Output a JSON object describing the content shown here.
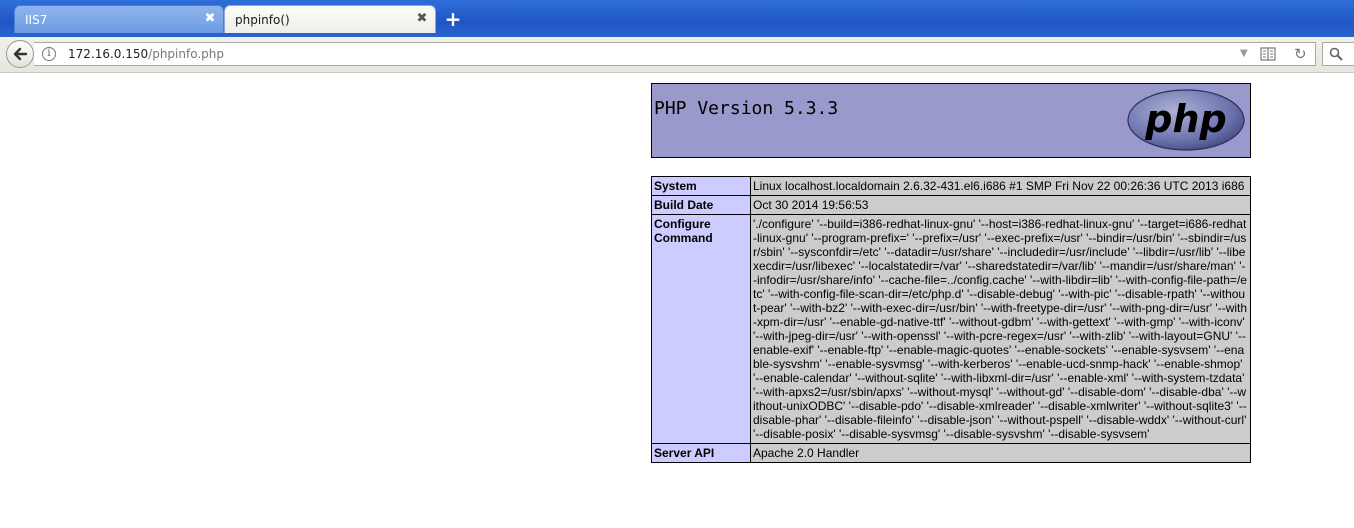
{
  "browser": {
    "tabs": [
      {
        "label": "IIS7",
        "active": false
      },
      {
        "label": "phpinfo()",
        "active": true
      }
    ],
    "new_tab_label": "+",
    "close_glyph": "✖",
    "url_host": "172.16.0.150",
    "url_path": "/phpinfo.php",
    "info_glyph": "i",
    "reload_glyph": "↻",
    "dropdown_glyph": "▼",
    "icons": [
      "back-arrow-icon",
      "info-icon",
      "reader-view-icon",
      "reload-icon",
      "search-icon",
      "close-icon",
      "new-tab-icon"
    ]
  },
  "php": {
    "version_title": "PHP Version 5.3.3",
    "logo_text": "php",
    "colors": {
      "header_bg": "#9999cc",
      "key_bg": "#ccccff",
      "value_bg": "#cccccc"
    },
    "rows": [
      {
        "key": "System",
        "value": "Linux localhost.localdomain 2.6.32-431.el6.i686 #1 SMP Fri Nov 22 00:26:36 UTC 2013 i686"
      },
      {
        "key": "Build Date",
        "value": "Oct 30 2014 19:56:53"
      },
      {
        "key": "Configure Command",
        "value": "'./configure' '--build=i386-redhat-linux-gnu' '--host=i386-redhat-linux-gnu' '--target=i686-redhat-linux-gnu' '--program-prefix=' '--prefix=/usr' '--exec-prefix=/usr' '--bindir=/usr/bin' '--sbindir=/usr/sbin' '--sysconfdir=/etc' '--datadir=/usr/share' '--includedir=/usr/include' '--libdir=/usr/lib' '--libexecdir=/usr/libexec' '--localstatedir=/var' '--sharedstatedir=/var/lib' '--mandir=/usr/share/man' '--infodir=/usr/share/info' '--cache-file=../config.cache' '--with-libdir=lib' '--with-config-file-path=/etc' '--with-config-file-scan-dir=/etc/php.d' '--disable-debug' '--with-pic' '--disable-rpath' '--without-pear' '--with-bz2' '--with-exec-dir=/usr/bin' '--with-freetype-dir=/usr' '--with-png-dir=/usr' '--with-xpm-dir=/usr' '--enable-gd-native-ttf' '--without-gdbm' '--with-gettext' '--with-gmp' '--with-iconv' '--with-jpeg-dir=/usr' '--with-openssl' '--with-pcre-regex=/usr' '--with-zlib' '--with-layout=GNU' '--enable-exif' '--enable-ftp' '--enable-magic-quotes' '--enable-sockets' '--enable-sysvsem' '--enable-sysvshm' '--enable-sysvmsg' '--with-kerberos' '--enable-ucd-snmp-hack' '--enable-shmop' '--enable-calendar' '--without-sqlite' '--with-libxml-dir=/usr' '--enable-xml' '--with-system-tzdata' '--with-apxs2=/usr/sbin/apxs' '--without-mysql' '--without-gd' '--disable-dom' '--disable-dba' '--without-unixODBC' '--disable-pdo' '--disable-xmlreader' '--disable-xmlwriter' '--without-sqlite3' '--disable-phar' '--disable-fileinfo' '--disable-json' '--without-pspell' '--disable-wddx' '--without-curl' '--disable-posix' '--disable-sysvmsg' '--disable-sysvshm' '--disable-sysvsem'"
      },
      {
        "key": "Server API",
        "value": "Apache 2.0 Handler"
      }
    ]
  }
}
